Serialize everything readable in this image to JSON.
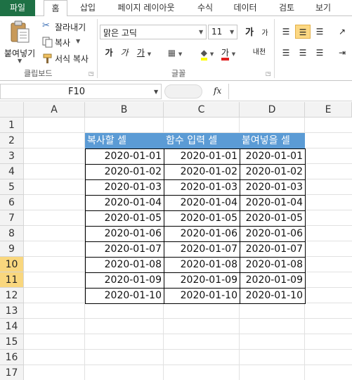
{
  "ribbon_tabs": [
    "파일",
    "홈",
    "삽입",
    "페이지 레이아웃",
    "수식",
    "데이터",
    "검토",
    "보기"
  ],
  "active_tab": "홈",
  "clipboard": {
    "paste": "붙여넣기",
    "cut": "잘라내기",
    "copy": "복사",
    "format_painter": "서식 복사",
    "group_label": "클립보드"
  },
  "font": {
    "name": "맑은 고딕",
    "size": "11",
    "grow": "가",
    "shrink": "가",
    "bold": "가",
    "italic": "가",
    "underline": "가",
    "font_color": "가",
    "phonetic": "내천",
    "group_label": "글꼴"
  },
  "formula_bar": {
    "name_box": "F10",
    "fx": "fx",
    "value": ""
  },
  "columns": [
    "A",
    "B",
    "C",
    "D",
    "E"
  ],
  "rows": [
    "1",
    "2",
    "3",
    "4",
    "5",
    "6",
    "7",
    "8",
    "9",
    "10",
    "11",
    "12",
    "13",
    "14",
    "15",
    "16",
    "17"
  ],
  "selected_rows": [
    "10",
    "11"
  ],
  "table": {
    "headers": [
      "복사할 셀",
      "함수 입력 셀",
      "붙여넣을 셀"
    ],
    "rows": [
      [
        "2020-01-01",
        "2020-01-01",
        "2020-01-01"
      ],
      [
        "2020-01-02",
        "2020-01-02",
        "2020-01-02"
      ],
      [
        "2020-01-03",
        "2020-01-03",
        "2020-01-03"
      ],
      [
        "2020-01-04",
        "2020-01-04",
        "2020-01-04"
      ],
      [
        "2020-01-05",
        "2020-01-05",
        "2020-01-05"
      ],
      [
        "2020-01-06",
        "2020-01-06",
        "2020-01-06"
      ],
      [
        "2020-01-07",
        "2020-01-07",
        "2020-01-07"
      ],
      [
        "2020-01-08",
        "2020-01-08",
        "2020-01-08"
      ],
      [
        "2020-01-09",
        "2020-01-09",
        "2020-01-09"
      ],
      [
        "2020-01-10",
        "2020-01-10",
        "2020-01-10"
      ]
    ]
  },
  "colors": {
    "file_tab": "#1e7145",
    "header_fill": "#5b9bd5",
    "selected_row_header": "#f9d77e"
  }
}
